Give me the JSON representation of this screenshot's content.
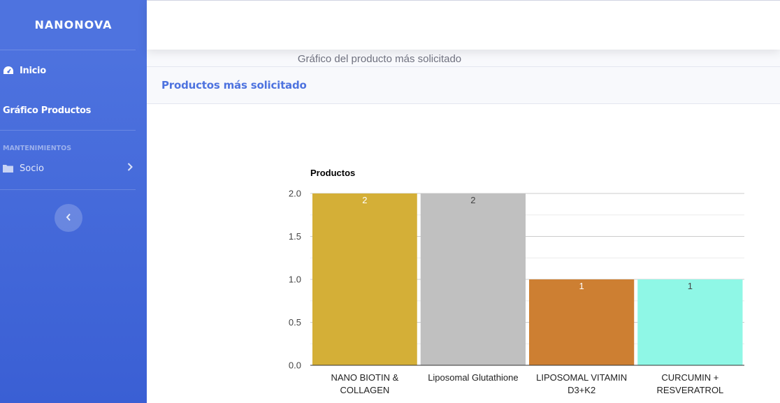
{
  "sidebar": {
    "brand": "NANONOVA",
    "items": [
      {
        "label": "Inicio",
        "icon": "tachometer-icon"
      },
      {
        "label": "Gráfico Productos"
      }
    ],
    "heading": "MANTENIMIENTOS",
    "group": {
      "label": "Socio",
      "icon": "folder-icon"
    },
    "toggle_icon": "chevron-left-icon"
  },
  "card": {
    "header": "Productos más solicitado",
    "chart_title": "Gráfico del producto más solicitado"
  },
  "chart_data": {
    "type": "bar",
    "title": "Gráfico del producto más solicitado",
    "ylabel": "Productos",
    "categories": [
      [
        "NANO BIOTIN &",
        "COLLAGEN"
      ],
      [
        "Liposomal Glutathione"
      ],
      [
        "LIPOSOMAL VITAMIN",
        "D3+K2"
      ],
      [
        "CURCUMIN +",
        "RESVERATROL"
      ]
    ],
    "values": [
      2,
      2,
      1,
      1
    ],
    "colors": [
      "#d4af37",
      "#c0c0c0",
      "#cd7f32",
      "#8ff7e6"
    ],
    "label_colors": [
      "#ffffff",
      "#444444",
      "#ffffff",
      "#444444"
    ],
    "ylim": [
      0,
      2
    ],
    "yticks": [
      "0.0",
      "0.5",
      "1.0",
      "1.5",
      "2.0"
    ],
    "grid": true,
    "colors_meta": {
      "accent": "#4e73df"
    }
  }
}
